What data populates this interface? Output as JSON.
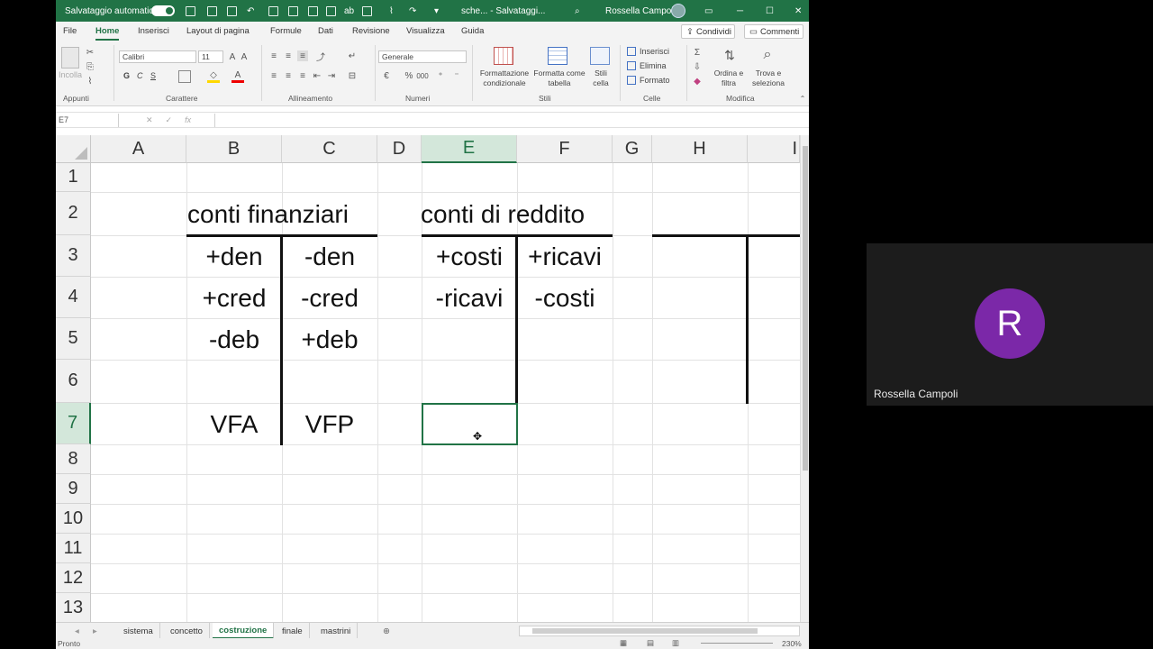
{
  "titlebar": {
    "autosave_label": "Salvataggio automatico",
    "file_status": "sche... - Salvataggi...",
    "user_name": "Rossella Campoli"
  },
  "menu": {
    "tabs": [
      "File",
      "Home",
      "Inserisci",
      "Layout di pagina",
      "Formule",
      "Dati",
      "Revisione",
      "Visualizza",
      "Guida"
    ],
    "active_tab": "Home",
    "share_label": "Condividi",
    "comments_label": "Commenti"
  },
  "ribbon": {
    "paste_label": "Incolla",
    "font_name": "Calibri",
    "font_size": "11",
    "bold": "G",
    "italic": "C",
    "underline": "S",
    "number_format": "Generale",
    "conditional_format": "Formattazione condizionale",
    "format_table": "Formatta come tabella",
    "cell_styles": "Stili cella",
    "insert": "Inserisci",
    "delete": "Elimina",
    "format": "Formato",
    "sort_filter": "Ordina e filtra",
    "find_select": "Trova e seleziona",
    "groups": {
      "clipboard": "Appunti",
      "font": "Carattere",
      "alignment": "Allineamento",
      "number": "Numeri",
      "styles": "Stili",
      "cells": "Celle",
      "editing": "Modifica"
    }
  },
  "formula_bar": {
    "name_box": "E7",
    "fx_label": "fx",
    "value": ""
  },
  "grid": {
    "columns": [
      "A",
      "B",
      "C",
      "D",
      "E",
      "F",
      "G",
      "H",
      "I"
    ],
    "selected_column": "E",
    "rows": [
      "1",
      "2",
      "3",
      "4",
      "5",
      "6",
      "7",
      "8",
      "9",
      "10",
      "11",
      "12",
      "13"
    ],
    "selected_row": "7",
    "cells": {
      "B2": "conti finanziari",
      "E2": "conti di reddito",
      "B3": "+den",
      "C3": "-den",
      "E3": "+costi",
      "F3": "+ricavi",
      "B4": "+cred",
      "C4": "-cred",
      "E4": "-ricavi",
      "F4": "-costi",
      "B5": "-deb",
      "C5": "+deb",
      "B7": "VFA",
      "C7": "VFP"
    }
  },
  "sheets": {
    "tabs": [
      "sistema",
      "concetto",
      "costruzione",
      "finale",
      "mastrini"
    ],
    "active": "costruzione"
  },
  "status": {
    "ready": "Pronto",
    "zoom": "230%"
  },
  "participant": {
    "initial": "R",
    "name": "Rossella Campoli",
    "avatar_color": "#7b28a8"
  },
  "colors": {
    "excel_green": "#217346"
  }
}
